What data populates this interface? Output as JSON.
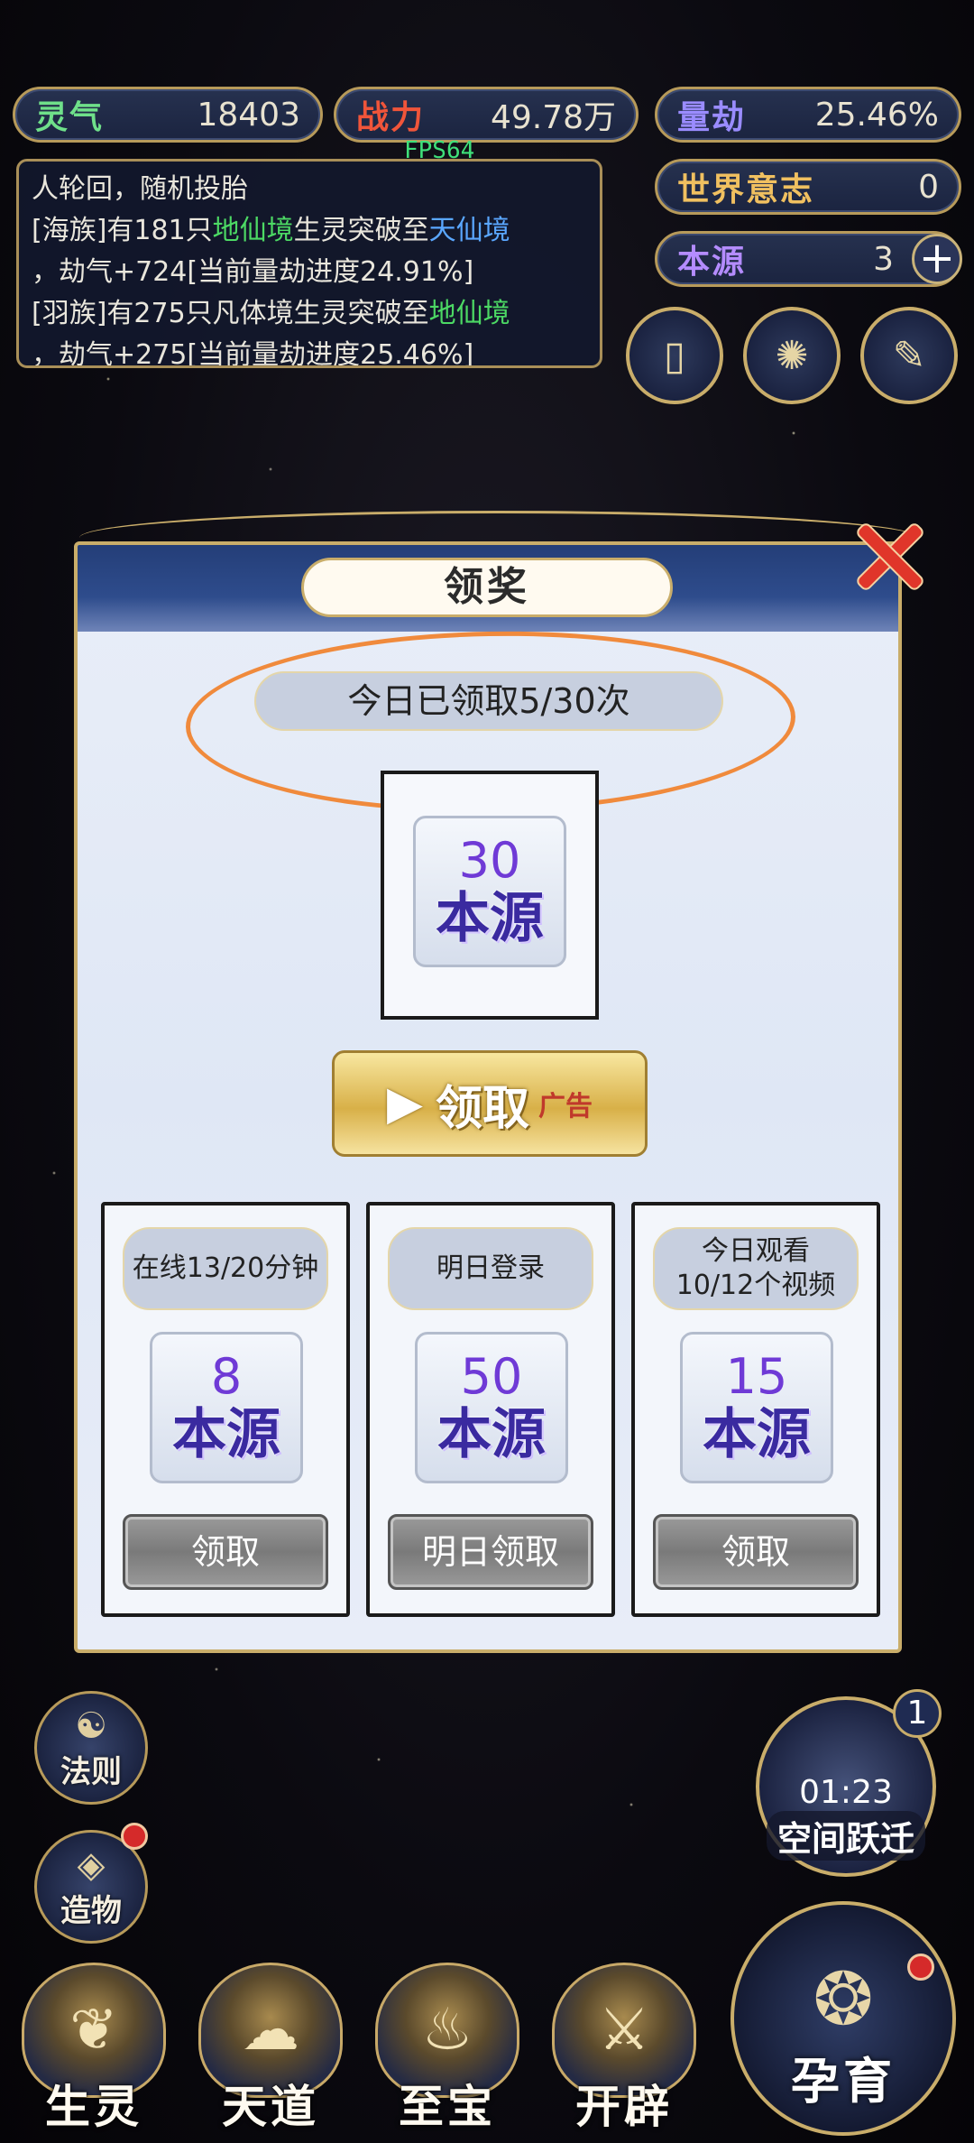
{
  "top_bar": {
    "lingqi": {
      "label": "灵气",
      "value": "18403"
    },
    "zhanli": {
      "label": "战力",
      "value": "49.78万"
    },
    "liangjie": {
      "label": "量劫",
      "value": "25.46%"
    },
    "shijie": {
      "label": "世界意志",
      "value": "0"
    },
    "benyuan": {
      "label": "本源",
      "value": "3"
    }
  },
  "fps": "FPS64",
  "log": {
    "line1": "人轮回，随机投胎",
    "line2_pre": "[海族]有181只",
    "line2_green": "地仙境",
    "line2_mid": "生灵突破至",
    "line2_blue": "天仙境",
    "line3": "，劫气+724[当前量劫进度24.91%]",
    "line4_pre": "[羽族]有275只凡体境生灵突破至",
    "line4_green": "地仙境",
    "line5": "，劫气+275[当前量劫进度25.46%]"
  },
  "modal": {
    "title": "领奖",
    "count_text": "今日已领取5/30次",
    "main_reward": {
      "amount": "30",
      "name": "本源"
    },
    "ad_button": {
      "label": "领取",
      "tag": "广告"
    },
    "tasks": [
      {
        "title": "在线13/20分钟",
        "amount": "8",
        "name": "本源",
        "button": "领取"
      },
      {
        "title": "明日登录",
        "amount": "50",
        "name": "本源",
        "button": "明日领取"
      },
      {
        "title": "今日观看\n10/12个视频",
        "amount": "15",
        "name": "本源",
        "button": "领取"
      }
    ]
  },
  "left_menu": {
    "faze": "法则",
    "zaowu": "造物"
  },
  "space_jump": {
    "timer": "01:23",
    "label": "空间跃迁",
    "badge": "1"
  },
  "bottom_nav": {
    "shengling": "生灵",
    "tiandao": "天道",
    "zhibao": "至宝",
    "kaipi": "开辟",
    "yunyu": "孕育"
  },
  "colors": {
    "accent_gold": "#c9ad6a",
    "highlight_orange": "#f08a3c",
    "reward_purple": "#6f3ad6",
    "log_green": "#4cd964",
    "log_blue": "#5aa7ff"
  }
}
